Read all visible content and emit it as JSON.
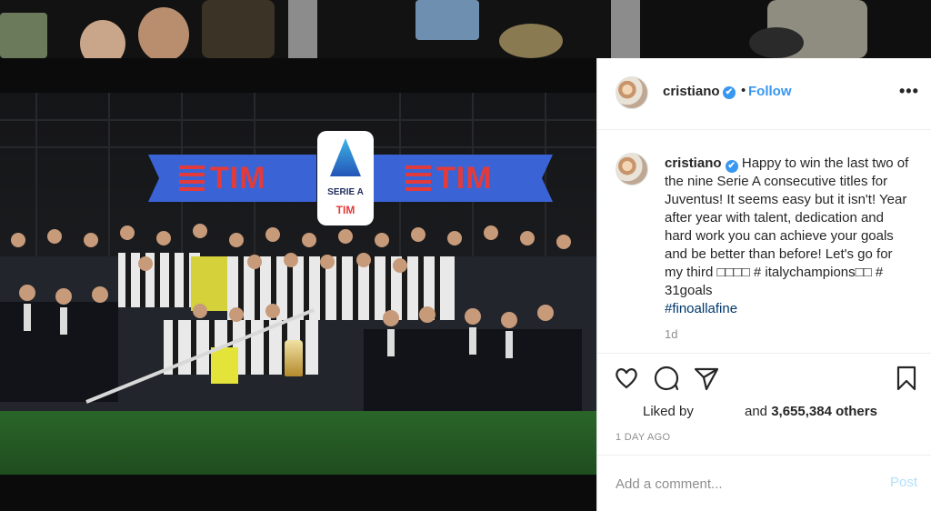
{
  "post": {
    "username": "cristiano",
    "verified_glyph": "✔",
    "dot": "•",
    "follow_label": "Follow",
    "more_glyph": "•••",
    "caption": {
      "username": "cristiano",
      "text": "Happy to win the last two of the nine Serie A consecutive titles for Juventus! It seems easy but it isn't! Year after year with talent, dedication and hard work you can achieve your goals and be better than before! Let's go for my third □□□□ # italychampions□□ # 31goals",
      "hashtag": "#finoallafine",
      "time": "1d"
    },
    "likes": {
      "liked_by": "Liked by",
      "count_prefix": "and",
      "count": "3,655,384 others"
    },
    "date": "1 DAY AGO",
    "comment": {
      "placeholder": "Add a comment...",
      "post_label": "Post"
    }
  },
  "photo": {
    "banner_left_text": "TIM",
    "banner_right_text": "TIM",
    "logo_label": "SERIE A",
    "logo_sponsor": "TIM"
  },
  "icons": {
    "like": "heart-icon",
    "comment": "comment-icon",
    "share": "share-icon",
    "save": "bookmark-icon"
  },
  "colors": {
    "accent": "#3897f0",
    "text": "#262626",
    "muted": "#8e8e8e",
    "banner_blue": "#3a64d6",
    "tim_red": "#e33b3b",
    "tim_green": "#2fbf6a"
  }
}
